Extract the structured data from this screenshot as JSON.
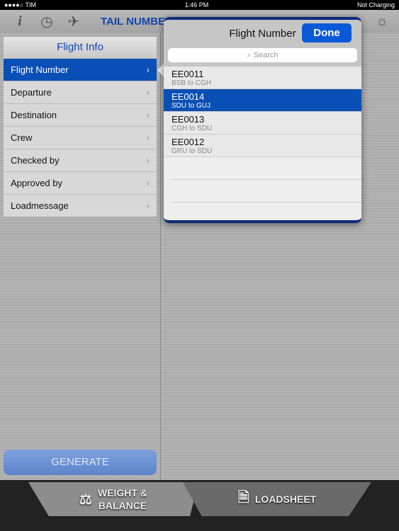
{
  "status": {
    "carrier": "●●●●○ TIM",
    "time": "1:46 PM",
    "battery": "Not Charging"
  },
  "toolbar": {
    "title": "TAIL NUMBE",
    "icons": [
      "info-icon",
      "clock-icon",
      "plane-icon",
      "gear-icon",
      "help-icon",
      "brightness-icon"
    ]
  },
  "panel": {
    "title": "Flight Info",
    "items": [
      {
        "label": "Flight Number",
        "selected": true
      },
      {
        "label": "Departure"
      },
      {
        "label": "Destination"
      },
      {
        "label": "Crew"
      },
      {
        "label": "Checked by"
      },
      {
        "label": "Approved by"
      },
      {
        "label": "Loadmessage"
      }
    ]
  },
  "generate": "GENERATE",
  "popover": {
    "title": "Flight Number",
    "done": "Done",
    "search_placeholder": "Search",
    "flights": [
      {
        "number": "EE0011",
        "route": "BSB to CGH"
      },
      {
        "number": "EE0014",
        "route": "SDU to GUJ",
        "selected": true
      },
      {
        "number": "EE0013",
        "route": "CGH to SDU"
      },
      {
        "number": "EE0012",
        "route": "GRU to SDU"
      }
    ]
  },
  "tabs": {
    "weight_balance_1": "WEIGHT &",
    "weight_balance_2": "BALANCE",
    "loadsheet": "LOADSHEET"
  }
}
